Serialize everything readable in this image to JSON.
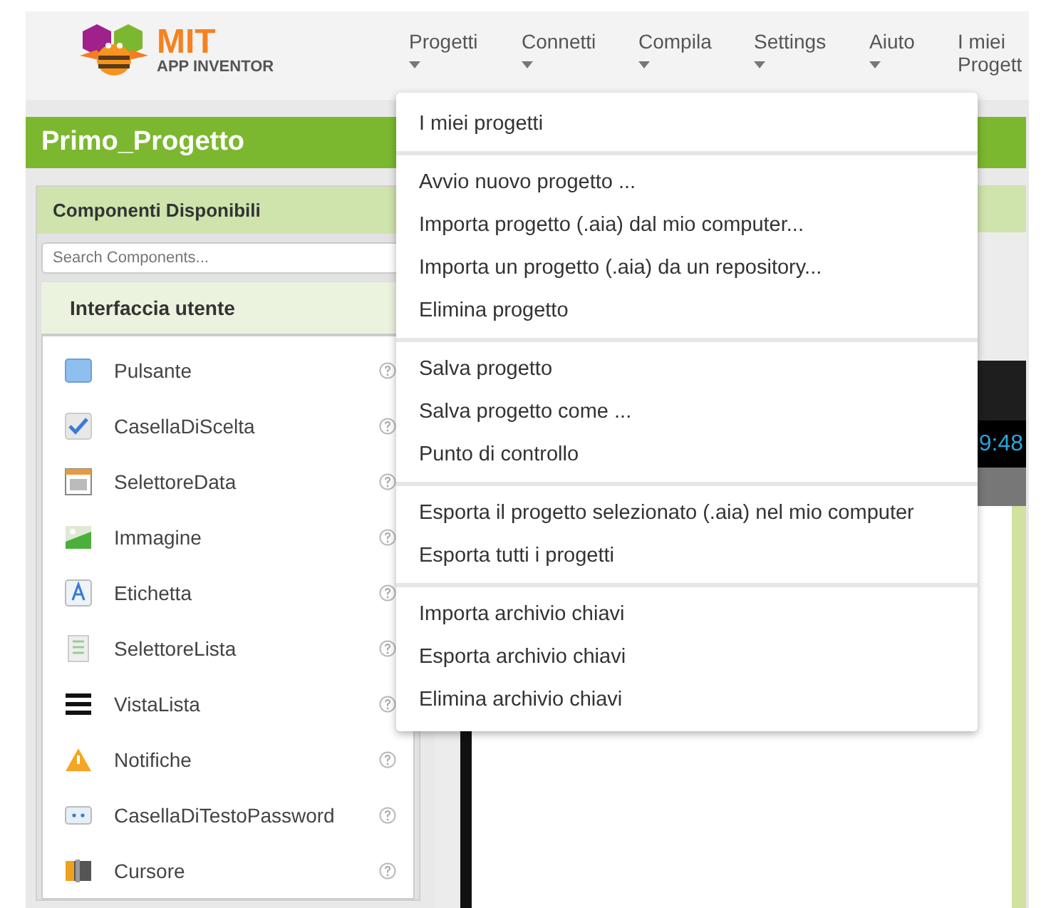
{
  "header": {
    "logo_title": "MIT",
    "logo_subtitle": "APP INVENTOR",
    "menus": [
      {
        "label": "Progetti",
        "caret": true
      },
      {
        "label": "Connetti",
        "caret": true
      },
      {
        "label": "Compila",
        "caret": true
      },
      {
        "label": "Settings",
        "caret": true
      },
      {
        "label": "Aiuto",
        "caret": true
      },
      {
        "label": "I miei Progett",
        "caret": false
      }
    ]
  },
  "project_title": "Primo_Progetto",
  "palette": {
    "title": "Componenti Disponibili",
    "search": {
      "placeholder": "Search Components..."
    },
    "category": "Interfaccia utente",
    "items": [
      {
        "label": "Pulsante",
        "kind": "button"
      },
      {
        "label": "CasellaDiScelta",
        "kind": "checkbox"
      },
      {
        "label": "SelettoreData",
        "kind": "datepicker"
      },
      {
        "label": "Immagine",
        "kind": "image"
      },
      {
        "label": "Etichetta",
        "kind": "label"
      },
      {
        "label": "SelettoreLista",
        "kind": "listpicker"
      },
      {
        "label": "VistaLista",
        "kind": "listview"
      },
      {
        "label": "Notifiche",
        "kind": "notifier"
      },
      {
        "label": "CasellaDiTestoPassword",
        "kind": "password"
      },
      {
        "label": "Cursore",
        "kind": "slider"
      }
    ]
  },
  "phone": {
    "clock": "9:48"
  },
  "dropdown_menu": {
    "groups": [
      [
        "I miei progetti"
      ],
      [
        "Avvio nuovo progetto ...",
        "Importa progetto (.aia) dal mio computer...",
        "Importa un progetto (.aia) da un repository...",
        "Elimina progetto"
      ],
      [
        "Salva progetto",
        "Salva progetto come ...",
        "Punto di controllo"
      ],
      [
        "Esporta il progetto selezionato (.aia) nel mio computer",
        "Esporta tutti i progetti"
      ],
      [
        "Importa archivio chiavi",
        "Esporta archivio chiavi",
        "Elimina archivio chiavi"
      ]
    ]
  }
}
